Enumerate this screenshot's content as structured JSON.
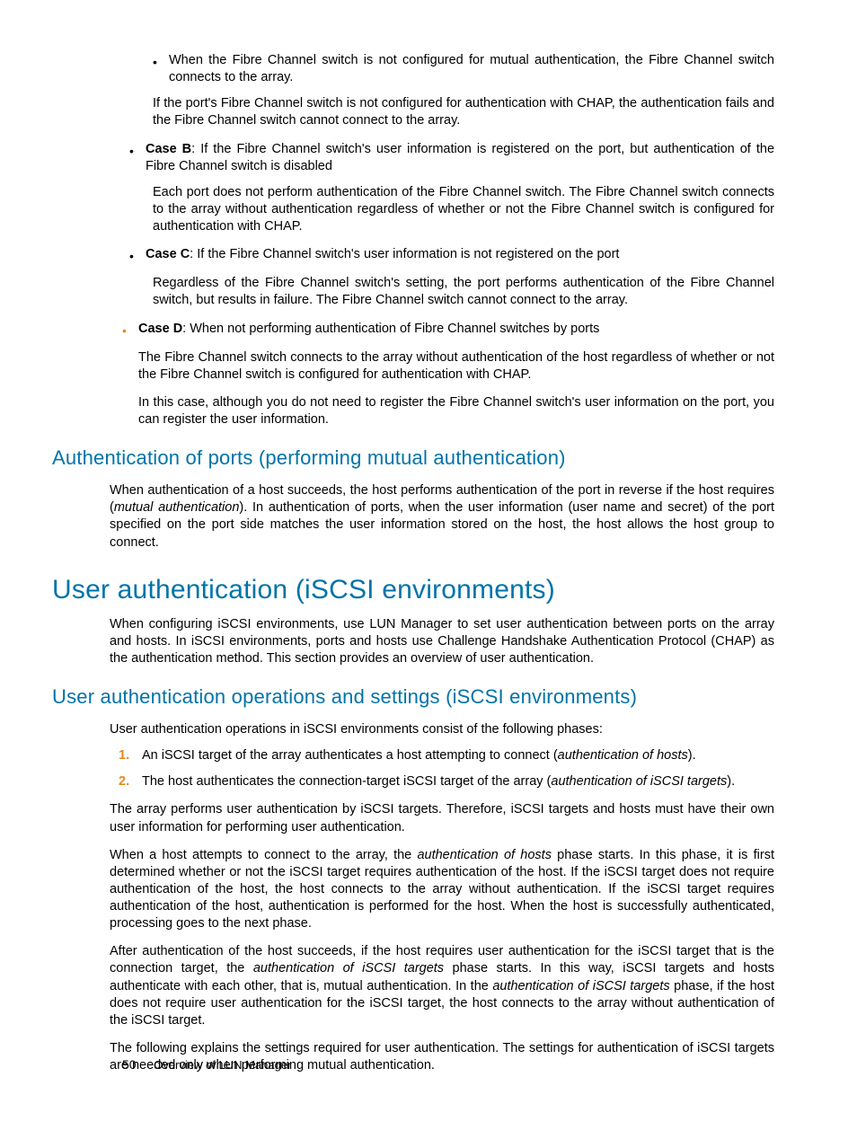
{
  "topBullets": {
    "sub1": "When the Fibre Channel switch is not configured for mutual authentication, the Fibre Channel switch connects to the array.",
    "sub1_follow": "If the port's Fibre Channel switch is not configured for authentication with CHAP, the authentication fails and the Fibre Channel switch cannot connect to the array."
  },
  "caseB": {
    "label": "Case B",
    "lead": ": If the Fibre Channel switch's user information is registered on the port, but authentication of the Fibre Channel switch is disabled",
    "para": "Each port does not perform authentication of the Fibre Channel switch. The Fibre Channel switch connects to the array without authentication regardless of whether or not the Fibre Channel switch is configured for authentication with CHAP."
  },
  "caseC": {
    "label": "Case C",
    "lead": ": If the Fibre Channel switch's user information is not registered on the port",
    "para": "Regardless of the Fibre Channel switch's setting, the port performs authentication of the Fibre Channel switch, but results in failure. The Fibre Channel switch cannot connect to the array."
  },
  "caseD": {
    "label": "Case D",
    "lead": ": When not performing authentication of Fibre Channel switches by ports",
    "para1": "The Fibre Channel switch connects to the array without authentication of the host regardless of whether or not the Fibre Channel switch is configured for authentication with CHAP.",
    "para2": "In this case, although you do not need to register the Fibre Channel switch's user information on the port, you can register the user information."
  },
  "h2a": "Authentication of ports (performing mutual authentication)",
  "authPorts": {
    "p1a": "When authentication of a host succeeds, the host performs authentication of the port in reverse if the host requires (",
    "p1b": "mutual authentication",
    "p1c": "). In authentication of ports, when the user information (user name and secret) of the port specified on the port side matches the user information stored on the host, the host allows the host group to connect."
  },
  "h1": "User authentication (iSCSI environments)",
  "iscsiIntro": "When configuring iSCSI environments, use LUN Manager to set user authentication between ports on the array and hosts. In iSCSI environments, ports and hosts use Challenge Handshake Authentication Protocol (CHAP) as the authentication method. This section provides an overview of user authentication.",
  "h2b": "User authentication operations and settings (iSCSI environments)",
  "opsIntro": "User authentication operations in iSCSI environments consist of the following phases:",
  "step1": {
    "num": "1.",
    "a": "An iSCSI target of the array authenticates a host attempting to connect (",
    "b": "authentication of hosts",
    "c": ")."
  },
  "step2": {
    "num": "2.",
    "a": "The host authenticates the connection-target iSCSI target of the array (",
    "b": "authentication of iSCSI targets",
    "c": ")."
  },
  "para_arr": "The array performs user authentication by iSCSI targets. Therefore, iSCSI targets and hosts must have their own user information for performing user authentication.",
  "para_hostAttempt": {
    "a": "When a host attempts to connect to the array, the ",
    "b": "authentication of hosts",
    "c": " phase starts. In this phase, it is first determined whether or not the iSCSI target requires authentication of the host. If the iSCSI target does not require authentication of the host, the host connects to the array without authentication. If the iSCSI target requires authentication of the host, authentication is performed for the host. When the host is successfully authenticated, processing goes to the next phase."
  },
  "para_after": {
    "a": "After authentication of the host succeeds, if the host requires user authentication for the iSCSI target that is the connection target, the ",
    "b": "authentication of iSCSI targets",
    "c": " phase starts. In this way, iSCSI targets and hosts authenticate with each other, that is, mutual authentication. In the ",
    "d": "authentication of iSCSI targets",
    "e": " phase, if the host does not require user authentication for the iSCSI target, the host connects to the array without authentication of the iSCSI target."
  },
  "para_settings": "The following explains the settings required for user authentication. The settings for authentication of iSCSI targets are needed only when performing mutual authentication.",
  "footer": {
    "page": "50",
    "title": "Overview of LUN Manager"
  }
}
